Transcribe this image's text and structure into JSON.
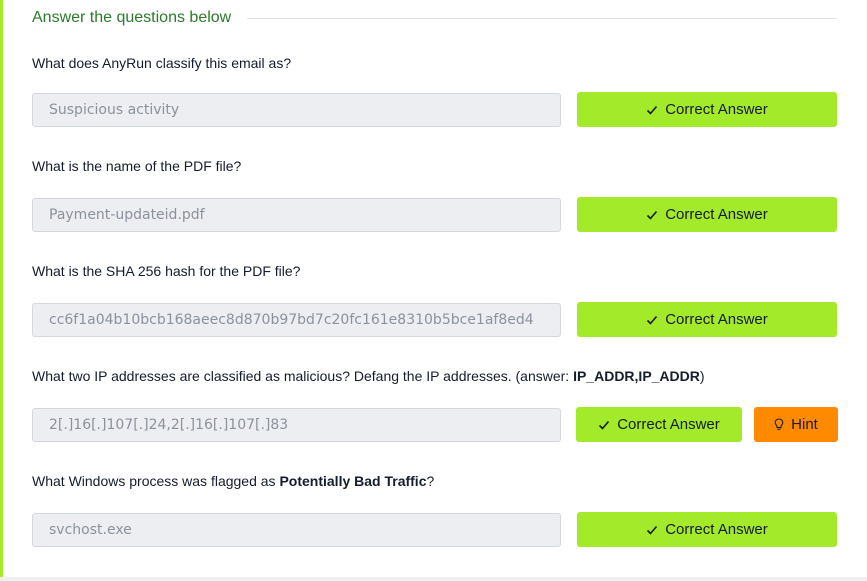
{
  "section": {
    "title": "Answer the questions below"
  },
  "questions": [
    {
      "prefix": "What does AnyRun classify this email as?",
      "bold": "",
      "suffix": "",
      "answer": "Suspicious activity",
      "button_label": "Correct Answer",
      "button_icon": "check-icon"
    },
    {
      "prefix": "What is the name of the PDF file?",
      "bold": "",
      "suffix": "",
      "answer": "Payment-updateid.pdf",
      "button_label": "Correct Answer",
      "button_icon": "check-icon"
    },
    {
      "prefix": "What is the SHA 256 hash for the PDF file?",
      "bold": "",
      "suffix": "",
      "answer": "cc6f1a04b10bcb168aeec8d870b97bd7c20fc161e8310b5bce1af8ed4",
      "button_label": "Correct Answer",
      "button_icon": "check-icon"
    },
    {
      "prefix": "What two IP addresses are classified as malicious? Defang the IP addresses. (answer: ",
      "bold": "IP_ADDR,IP_ADDR",
      "suffix": ")",
      "answer": "2[.]16[.]107[.]24,2[.]16[.]107[.]83",
      "button_label": "Correct Answer",
      "button_icon": "check-icon",
      "hint_label": "Hint",
      "hint_icon": "lightbulb-icon"
    },
    {
      "prefix": "What Windows process was flagged as ",
      "bold": "Potentially Bad Traffic",
      "suffix": "?",
      "answer": "svchost.exe",
      "button_label": "Correct Answer",
      "button_icon": "check-icon"
    }
  ],
  "colors": {
    "accent": "#a3ea2a",
    "hint": "#ff8a00",
    "title": "#2c7a2b",
    "text": "#151c2b",
    "field_bg": "#eceef1",
    "field_text": "#8c929c"
  }
}
